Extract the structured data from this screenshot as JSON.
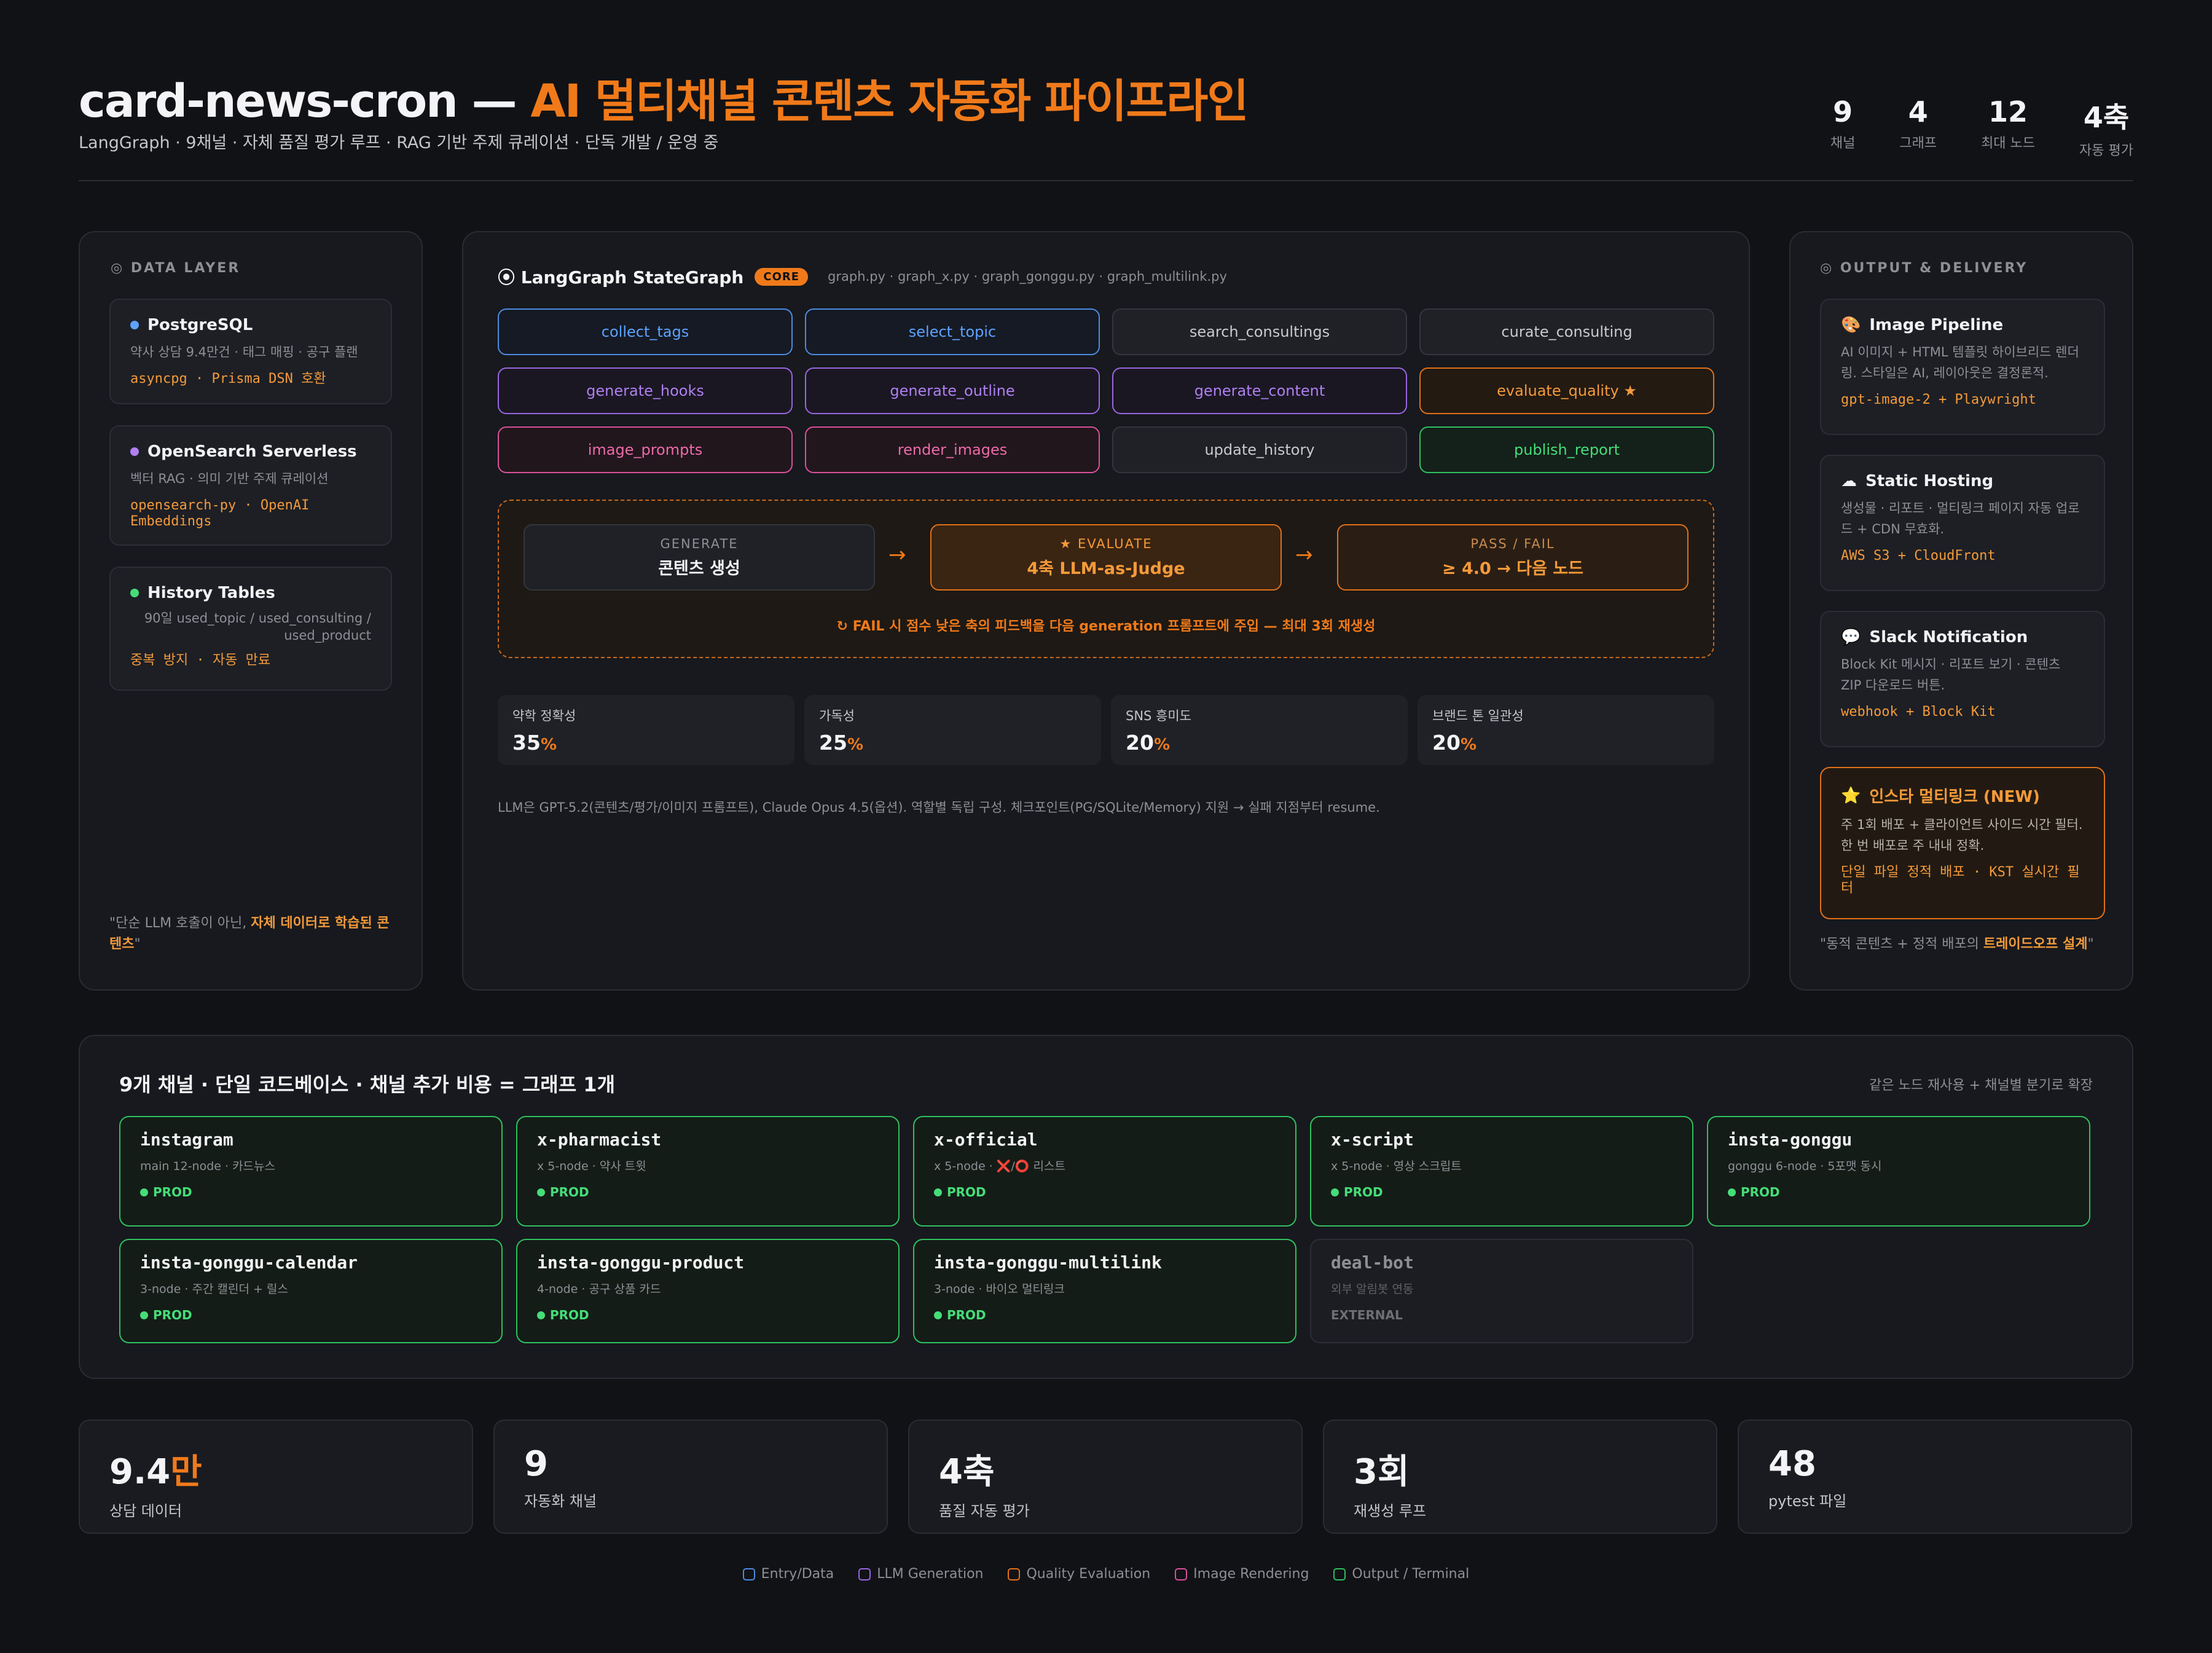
{
  "header": {
    "title_main": "card-news-cron — ",
    "title_accent": "AI 멀티채널 콘텐츠 자동화 파이프라인",
    "subtitle": "LangGraph · 9채널 · 자체 품질 평가 루프 · RAG 기반 주제 큐레이션 · 단독 개발 / 운영 중",
    "stats": [
      {
        "value": "9",
        "label": "채널"
      },
      {
        "value": "4",
        "label": "그래프"
      },
      {
        "value": "12",
        "label": "최대 노드"
      },
      {
        "value": "4축",
        "label": "자동 평가"
      }
    ]
  },
  "data_layer": {
    "heading": "DATA LAYER",
    "cards": [
      {
        "title": "PostgreSQL",
        "dot_color": "#5ea2ff",
        "desc": "약사 상담 9.4만건 · 태그 매핑 · 공구 플랜",
        "tech": "asyncpg · Prisma DSN 호환"
      },
      {
        "title": "OpenSearch Serverless",
        "dot_color": "#b07ff0",
        "desc": "벡터 RAG · 의미 기반 주제 큐레이션",
        "tech": "opensearch-py · OpenAI Embeddings"
      },
      {
        "title": "History Tables",
        "dot_color": "#45dd78",
        "desc": "90일 used_topic / used_consulting / used_product",
        "tech": "중복 방지 · 자동 만료"
      }
    ],
    "quote_start": "\"단순 LLM 호출이 아닌, ",
    "quote_bold": "자체 데이터로 학습된 콘텐츠",
    "quote_end": "\""
  },
  "graph": {
    "title": "LangGraph StateGraph",
    "badge": "CORE",
    "files": "graph.py · graph_x.py · graph_gonggu.py · graph_multilink.py",
    "nodes": [
      {
        "label": "collect_tags",
        "type": "entry"
      },
      {
        "label": "select_topic",
        "type": "entry"
      },
      {
        "label": "search_consultings",
        "type": "neutral"
      },
      {
        "label": "curate_consulting",
        "type": "neutral"
      },
      {
        "label": "generate_hooks",
        "type": "llm"
      },
      {
        "label": "generate_outline",
        "type": "llm"
      },
      {
        "label": "generate_content",
        "type": "llm"
      },
      {
        "label": "evaluate_quality ★",
        "type": "quality"
      },
      {
        "label": "image_prompts",
        "type": "image"
      },
      {
        "label": "render_images",
        "type": "image"
      },
      {
        "label": "update_history",
        "type": "neutral"
      },
      {
        "label": "publish_report",
        "type": "output"
      }
    ],
    "loop": {
      "generate_small": "GENERATE",
      "generate_big": "콘텐츠 생성",
      "evaluate_small": "★ EVALUATE",
      "evaluate_big": "4축 LLM-as-Judge",
      "pass_small": "PASS / FAIL",
      "pass_big": "≥ 4.0 → 다음 노드",
      "note": "FAIL 시 점수 낮은 축의 피드백을 다음 generation 프롬프트에 주입 — 최대 3회 재생성"
    },
    "metrics": [
      {
        "label": "약학 정확성",
        "value": "35",
        "unit": "%"
      },
      {
        "label": "가독성",
        "value": "25",
        "unit": "%"
      },
      {
        "label": "SNS 흥미도",
        "value": "20",
        "unit": "%"
      },
      {
        "label": "브랜드 톤 일관성",
        "value": "20",
        "unit": "%"
      }
    ],
    "footnote": "LLM은 GPT-5.2(콘텐츠/평가/이미지 프롬프트), Claude Opus 4.5(옵션). 역할별 독립 구성. 체크포인트(PG/SQLite/Memory) 지원 → 실패 지점부터 resume."
  },
  "output": {
    "heading": "OUTPUT & DELIVERY",
    "cards": [
      {
        "icon": "🎨",
        "title": "Image Pipeline",
        "desc": "AI 이미지 + HTML 템플릿 하이브리드 렌더링. 스타일은 AI, 레이아웃은 결정론적.",
        "tech": "gpt-image-2 + Playwright"
      },
      {
        "icon": "☁",
        "title": "Static Hosting",
        "desc": "생성물 · 리포트 · 멀티링크 페이지 자동 업로드 + CDN 무효화.",
        "tech": "AWS S3 + CloudFront"
      },
      {
        "icon": "💬",
        "title": "Slack Notification",
        "desc": "Block Kit 메시지 · 리포트 보기 · 콘텐츠 ZIP 다운로드 버튼.",
        "tech": "webhook + Block Kit"
      }
    ],
    "highlight": {
      "icon": "⭐",
      "title": "인스타 멀티링크 (NEW)",
      "desc": "주 1회 배포 + 클라이언트 사이드 시간 필터. 한 번 배포로 주 내내 정확.",
      "tech": "단일 파일 정적 배포 · KST 실시간 필터"
    },
    "quote_start": "\"동적 콘텐츠 + 정적 배포의 ",
    "quote_bold": "트레이드오프 설계",
    "quote_end": "\""
  },
  "channels": {
    "title": "9개 채널 · 단일 코드베이스 · 채널 추가 비용 = 그래프 1개",
    "note": "같은 노드 재사용 + 채널별 분기로 확장",
    "items": [
      {
        "name": "instagram",
        "desc": "main 12-node · 카드뉴스",
        "status": "PROD"
      },
      {
        "name": "x-pharmacist",
        "desc": "x 5-node · 약사 트윗",
        "status": "PROD"
      },
      {
        "name": "x-official",
        "desc": "x 5-node · ❌/⭕ 리스트",
        "status": "PROD"
      },
      {
        "name": "x-script",
        "desc": "x 5-node · 영상 스크립트",
        "status": "PROD"
      },
      {
        "name": "insta-gonggu",
        "desc": "gonggu 6-node · 5포맷 동시",
        "status": "PROD"
      },
      {
        "name": "insta-gonggu-calendar",
        "desc": "3-node · 주간 캘린더 + 릴스",
        "status": "PROD"
      },
      {
        "name": "insta-gonggu-product",
        "desc": "4-node · 공구 상품 카드",
        "status": "PROD"
      },
      {
        "name": "insta-gonggu-multilink",
        "desc": "3-node · 바이오 멀티링크",
        "status": "PROD"
      },
      {
        "name": "deal-bot",
        "desc": "외부 알림봇 연동",
        "status": "EXTERNAL"
      }
    ]
  },
  "bottom_stats": [
    {
      "value": "9.4",
      "accent": "만",
      "label": "상담 데이터"
    },
    {
      "value": "9",
      "accent": "",
      "label": "자동화 채널"
    },
    {
      "value": "4축",
      "accent": "",
      "label": "품질 자동 평가"
    },
    {
      "value": "3회",
      "accent": "",
      "label": "재생성 루프"
    },
    {
      "value": "48",
      "accent": "",
      "label": "pytest 파일"
    }
  ],
  "legend": [
    {
      "label": "Entry/Data",
      "color": "#4d8be0"
    },
    {
      "label": "LLM Generation",
      "color": "#9a66e0"
    },
    {
      "label": "Quality Evaluation",
      "color": "#e07018"
    },
    {
      "label": "Image Rendering",
      "color": "#d9509a"
    },
    {
      "label": "Output / Terminal",
      "color": "#2fbf5f"
    }
  ]
}
